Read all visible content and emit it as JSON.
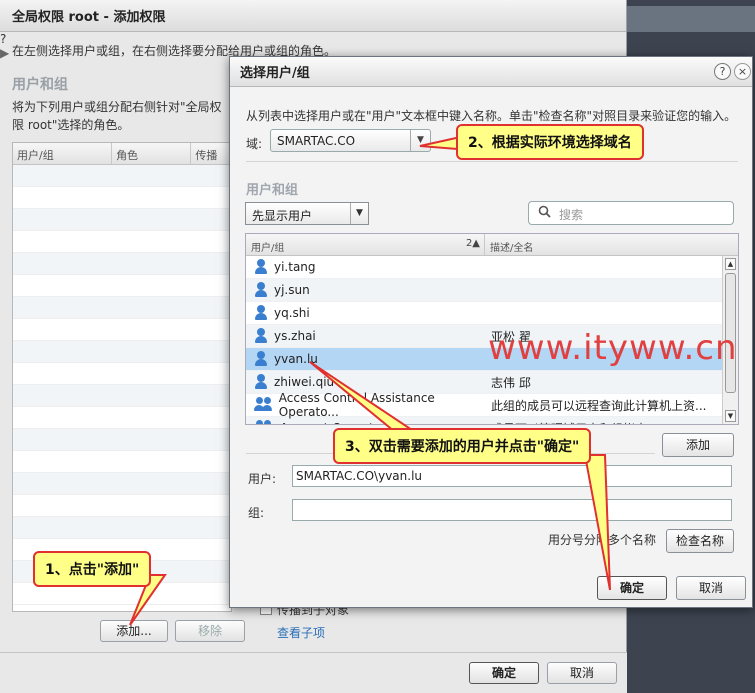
{
  "base": {
    "title": "全局权限 root - 添加权限",
    "desc": "在左侧选择用户或组，在右侧选择要分配给用户或组的角色。",
    "section": "用户和组",
    "sub": "将为下列用户或组分配右侧针对\"全局权限 root\"选择的角色。",
    "col_user": "用户/组",
    "col_role": "角色",
    "col_prop": "传播",
    "add_btn": "添加...",
    "remove_btn": "移除",
    "propagate_label": "传播到子对象",
    "view_children": "查看子项",
    "ok": "确定",
    "cancel": "取消"
  },
  "modal": {
    "title": "选择用户/组",
    "help": "?",
    "close": "×",
    "desc": "从列表中选择用户或在\"用户\"文本框中键入名称。单击\"检查名称\"对照目录来验证您的输入。",
    "domain_label": "域:",
    "domain_value": "SMARTAC.CO",
    "section": "用户和组",
    "show_select": "先显示用户",
    "search_placeholder": "搜索",
    "col_user": "用户/组",
    "col_sort": "2▲",
    "col_desc": "描述/全名",
    "rows": [
      {
        "name": "yi.tang",
        "desc": "",
        "type": "user"
      },
      {
        "name": "yj.sun",
        "desc": "",
        "type": "user"
      },
      {
        "name": "yq.shi",
        "desc": "",
        "type": "user"
      },
      {
        "name": "ys.zhai",
        "desc": "亚松 翟",
        "type": "user"
      },
      {
        "name": "yvan.lu",
        "desc": "",
        "type": "user"
      },
      {
        "name": "zhiwei.qiu",
        "desc": "志伟 邱",
        "type": "user"
      },
      {
        "name": "Access Control Assistance Operato...",
        "desc": "此组的成员可以远程查询此计算机上资...",
        "type": "group"
      },
      {
        "name": "Account Operators",
        "desc": "成员可以管理域用户和组帐户",
        "type": "group"
      }
    ],
    "add_btn": "添加",
    "user_label": "用户:",
    "user_value": "SMARTAC.CO\\yvan.lu",
    "group_label": "组:",
    "note": "用分号分隔多个名称",
    "check_btn": "检查名称",
    "ok": "确定",
    "cancel": "取消"
  },
  "callouts": {
    "c1": "1、点击\"添加\"",
    "c2": "2、根据实际环境选择域名",
    "c3": "3、双击需要添加的用户并点击\"确定\""
  },
  "watermark": "www.ityww.cn"
}
